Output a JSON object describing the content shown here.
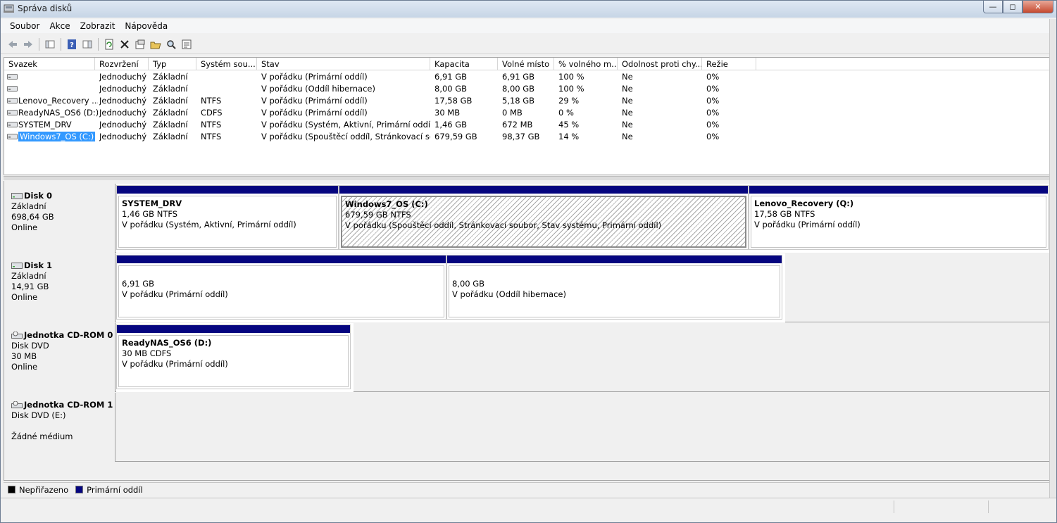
{
  "window": {
    "title": "Správa disků"
  },
  "menu": [
    "Soubor",
    "Akce",
    "Zobrazit",
    "Nápověda"
  ],
  "toolbar": [
    "back-arrow-icon",
    "forward-arrow-icon",
    "console-tree-icon",
    "help-icon",
    "properties-pane-icon",
    "refresh-icon",
    "delete-icon",
    "properties-icon",
    "open-folder-icon",
    "search-icon",
    "export-icon"
  ],
  "volume_list": {
    "columns": [
      "Svazek",
      "Rozvržení",
      "Typ",
      "Systém sou...",
      "Stav",
      "Kapacita",
      "Volné místo",
      "% volného m...",
      "Odolnost proti chy...",
      "Režie"
    ],
    "rows": [
      [
        "",
        "Jednoduchý",
        "Základní",
        "",
        "V pořádku (Primární oddíl)",
        "6,91 GB",
        "6,91 GB",
        "100 %",
        "Ne",
        "0%"
      ],
      [
        "",
        "Jednoduchý",
        "Základní",
        "",
        "V pořádku (Oddíl hibernace)",
        "8,00 GB",
        "8,00 GB",
        "100 %",
        "Ne",
        "0%"
      ],
      [
        "Lenovo_Recovery ...",
        "Jednoduchý",
        "Základní",
        "NTFS",
        "V pořádku (Primární oddíl)",
        "17,58 GB",
        "5,18 GB",
        "29 %",
        "Ne",
        "0%"
      ],
      [
        "ReadyNAS_OS6 (D:)",
        "Jednoduchý",
        "Základní",
        "CDFS",
        "V pořádku (Primární oddíl)",
        "30 MB",
        "0 MB",
        "0 %",
        "Ne",
        "0%"
      ],
      [
        "SYSTEM_DRV",
        "Jednoduchý",
        "Základní",
        "NTFS",
        "V pořádku (Systém, Aktivní, Primární oddíl)",
        "1,46 GB",
        "672 MB",
        "45 %",
        "Ne",
        "0%"
      ],
      [
        "Windows7_OS (C:)",
        "Jednoduchý",
        "Základní",
        "NTFS",
        "V pořádku (Spouštěcí oddíl, Stránkovací so...",
        "679,59 GB",
        "98,37 GB",
        "14 %",
        "Ne",
        "0%"
      ]
    ],
    "selected_row": 5
  },
  "disks": [
    {
      "name": "Disk 0",
      "type": "Základní",
      "size": "698,64 GB",
      "status": "Online",
      "partitions": [
        {
          "name": "SYSTEM_DRV",
          "info": "1,46 GB NTFS",
          "status": "V pořádku (Systém, Aktivní, Primární oddíl)"
        },
        {
          "name": "Windows7_OS  (C:)",
          "info": "679,59 GB NTFS",
          "status": "V pořádku (Spouštěcí oddíl, Stránkovací soubor, Stav systému, Primární oddíl)"
        },
        {
          "name": "Lenovo_Recovery  (Q:)",
          "info": "17,58 GB NTFS",
          "status": "V pořádku (Primární oddíl)"
        }
      ]
    },
    {
      "name": "Disk 1",
      "type": "Základní",
      "size": "14,91 GB",
      "status": "Online",
      "partitions": [
        {
          "name": "",
          "info": "6,91 GB",
          "status": "V pořádku (Primární oddíl)"
        },
        {
          "name": "",
          "info": "8,00 GB",
          "status": "V pořádku (Oddíl hibernace)"
        }
      ]
    },
    {
      "name": "Jednotka CD-ROM 0",
      "type": "Disk DVD",
      "size": "30 MB",
      "status": "Online",
      "partitions": [
        {
          "name": "ReadyNAS_OS6  (D:)",
          "info": "30 MB CDFS",
          "status": "V pořádku (Primární oddíl)"
        }
      ]
    },
    {
      "name": "Jednotka CD-ROM 1",
      "type": "Disk DVD (E:)",
      "size": "",
      "status": "Žádné médium",
      "partitions": []
    }
  ],
  "legend": [
    {
      "label": "Nepřiřazeno",
      "color": "#000000"
    },
    {
      "label": "Primární oddíl",
      "color": "#05057f"
    }
  ],
  "colors": {
    "partition_bar": "#05057f",
    "selection": "#3399ff"
  }
}
